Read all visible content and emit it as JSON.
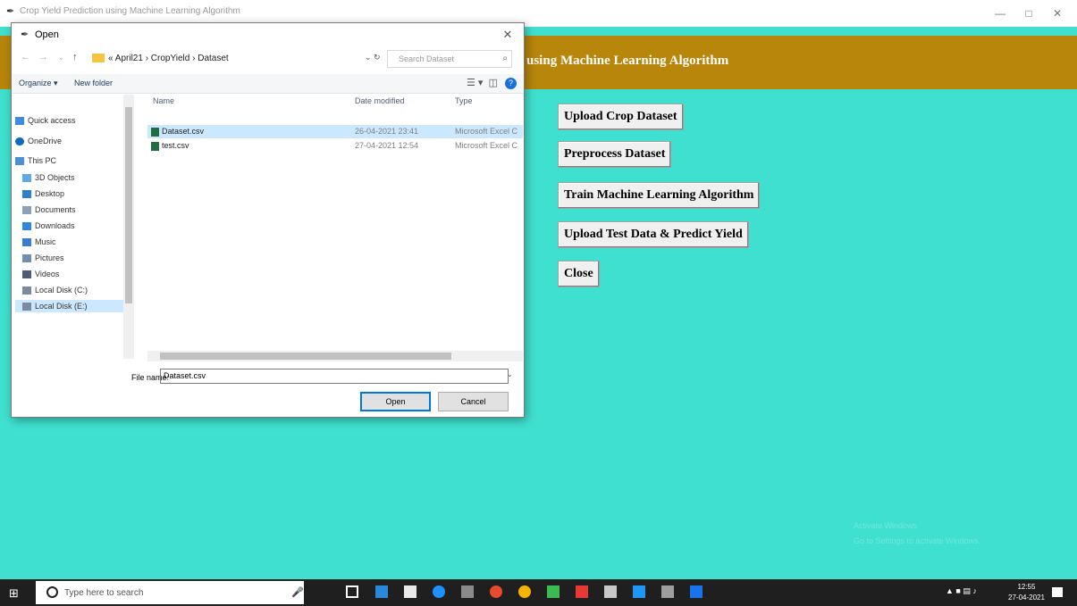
{
  "app": {
    "window_title": "Crop Yield Prediction using Machine Learning Algorithm",
    "header_title": "using Machine Learning Algorithm",
    "buttons": [
      "Upload Crop Dataset",
      "Preprocess Dataset",
      "Train Machine Learning Algorithm",
      "Upload Test Data & Predict Yield",
      "Close"
    ],
    "watermark_line1": "Activate Windows",
    "watermark_line2": "Go to Settings to activate Windows."
  },
  "dialog": {
    "title": "Open",
    "breadcrumb": "« April21 › CropYield › Dataset",
    "search_placeholder": "Search Dataset",
    "organize_label": "Organize ▾",
    "new_folder_label": "New folder",
    "nav_items": [
      {
        "label": "Quick access",
        "color": "#3c8ce7"
      },
      {
        "label": "OneDrive",
        "color": "#0f6cbd"
      },
      {
        "label": "This PC",
        "color": "#4a90d9"
      },
      {
        "label": "3D Objects",
        "color": "#5fa9e6"
      },
      {
        "label": "Desktop",
        "color": "#2f7fd1"
      },
      {
        "label": "Documents",
        "color": "#8aa1b8"
      },
      {
        "label": "Downloads",
        "color": "#2e86de"
      },
      {
        "label": "Music",
        "color": "#3a7bd5"
      },
      {
        "label": "Pictures",
        "color": "#6f8fb0"
      },
      {
        "label": "Videos",
        "color": "#4b5e75"
      },
      {
        "label": "Local Disk (C:)",
        "color": "#7a8aa0"
      },
      {
        "label": "Local Disk (E:)",
        "color": "#7a8aa0"
      }
    ],
    "columns": {
      "name": "Name",
      "date": "Date modified",
      "type": "Type"
    },
    "files": [
      {
        "name": "Dataset.csv",
        "date": "26-04-2021 23:41",
        "type": "Microsoft Excel C"
      },
      {
        "name": "test.csv",
        "date": "27-04-2021 12:54",
        "type": "Microsoft Excel C"
      }
    ],
    "file_name_label": "File name:",
    "file_name_value": "Dataset.csv",
    "open_label": "Open",
    "cancel_label": "Cancel"
  },
  "taskbar": {
    "search_placeholder": "Type here to search",
    "time": "12:55",
    "date": "27-04-2021"
  }
}
